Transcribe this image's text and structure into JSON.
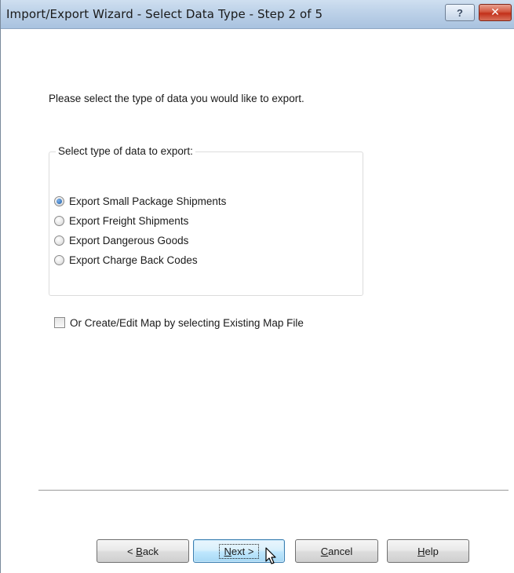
{
  "window": {
    "title": "Import/Export Wizard - Select Data Type - Step 2 of 5",
    "help_icon": "question-mark",
    "close_icon": "close-x"
  },
  "main": {
    "instruction": "Please select the type of data you would like to export."
  },
  "group": {
    "label": "Select type of data to export:",
    "options": [
      {
        "label": "Export Small Package Shipments",
        "checked": true
      },
      {
        "label": "Export Freight Shipments",
        "checked": false
      },
      {
        "label": "Export Dangerous Goods",
        "checked": false
      },
      {
        "label": "Export Charge Back Codes",
        "checked": false
      }
    ]
  },
  "map_option": {
    "label": "Or Create/Edit Map by selecting Existing Map File",
    "checked": false
  },
  "buttons": {
    "back": {
      "prefix": "< ",
      "mnemonic": "B",
      "rest": "ack"
    },
    "next": {
      "mnemonic": "N",
      "rest": "ext >"
    },
    "cancel": {
      "mnemonic": "C",
      "rest": "ancel"
    },
    "help": {
      "mnemonic": "H",
      "rest": "elp"
    }
  },
  "colors": {
    "titlebar": "#bcd1e8",
    "close": "#c3301a",
    "default_button": "#bee6fd"
  }
}
